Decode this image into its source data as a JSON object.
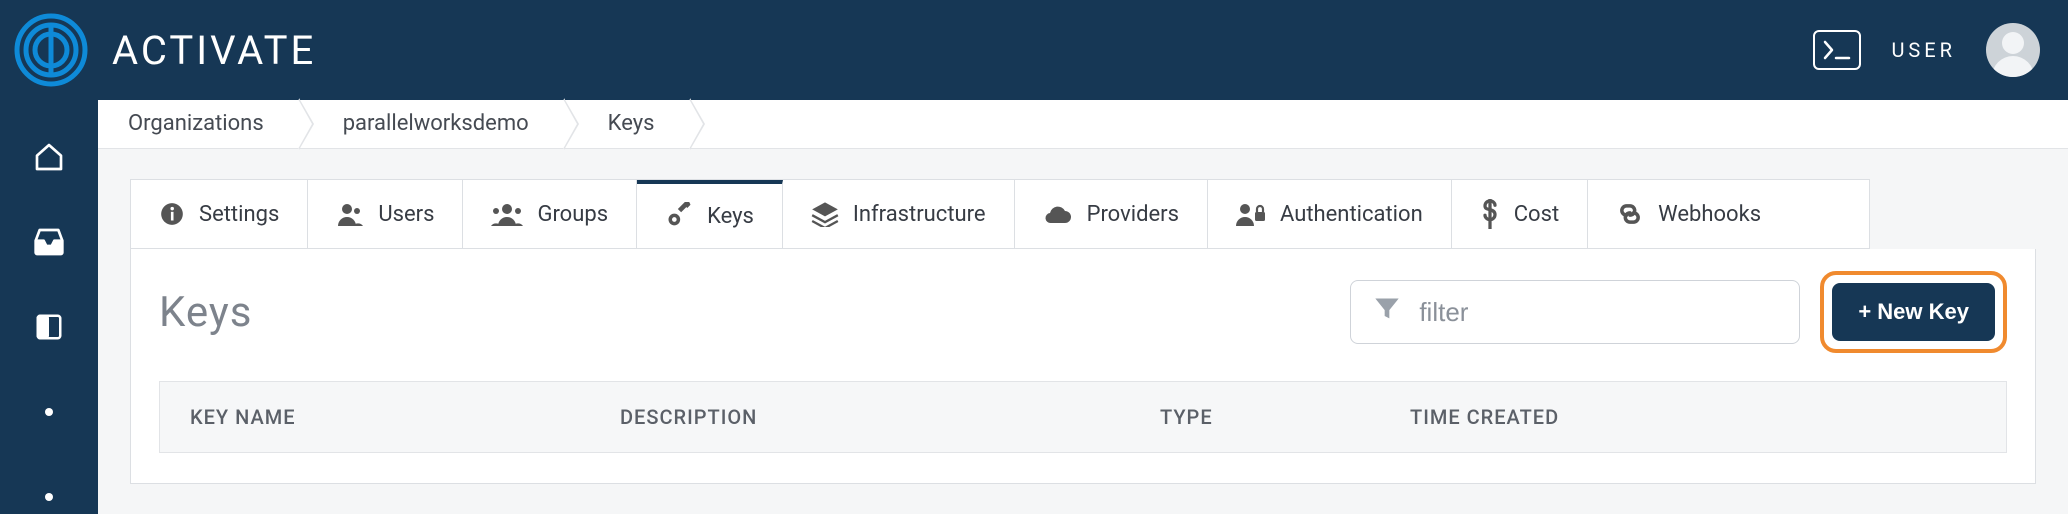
{
  "brand": {
    "name": "ACTIVATE"
  },
  "user": {
    "label": "USER"
  },
  "breadcrumbs": [
    {
      "label": "Organizations"
    },
    {
      "label": "parallelworksdemo"
    },
    {
      "label": "Keys"
    }
  ],
  "tabs": [
    {
      "label": "Settings"
    },
    {
      "label": "Users"
    },
    {
      "label": "Groups"
    },
    {
      "label": "Keys"
    },
    {
      "label": "Infrastructure"
    },
    {
      "label": "Providers"
    },
    {
      "label": "Authentication"
    },
    {
      "label": "Cost"
    },
    {
      "label": "Webhooks"
    }
  ],
  "panel": {
    "title": "Keys",
    "filter_placeholder": "filter",
    "new_button": "+ New Key"
  },
  "table": {
    "columns": [
      {
        "label": "KEY NAME"
      },
      {
        "label": "DESCRIPTION"
      },
      {
        "label": "TYPE"
      },
      {
        "label": "TIME CREATED"
      }
    ],
    "rows": []
  }
}
